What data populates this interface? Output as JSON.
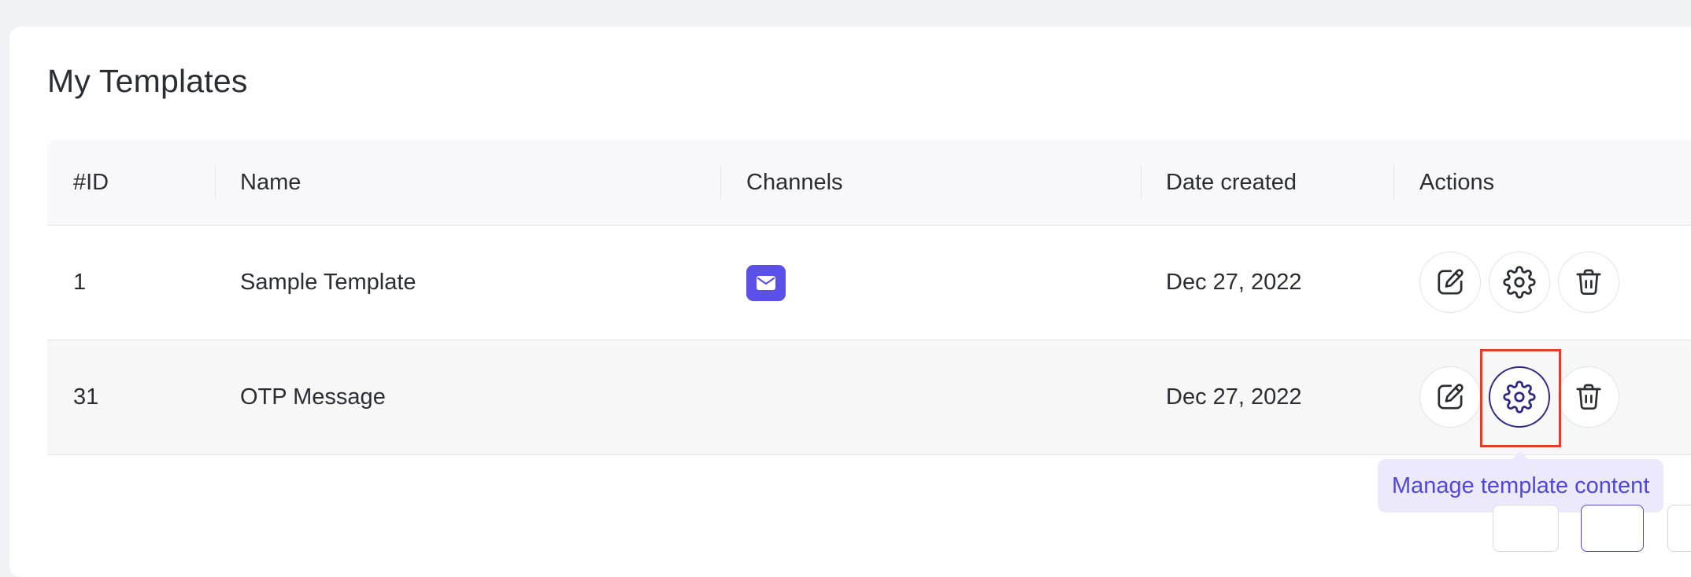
{
  "page": {
    "title": "My Templates"
  },
  "table": {
    "columns": [
      "#ID",
      "Name",
      "Channels",
      "Date created",
      "Actions"
    ],
    "rows": [
      {
        "id": "1",
        "name": "Sample Template",
        "channels": [
          "email"
        ],
        "date_created": "Dec 27, 2022",
        "actions": [
          "edit",
          "settings",
          "delete"
        ]
      },
      {
        "id": "31",
        "name": "OTP Message",
        "channels": [],
        "date_created": "Dec 27, 2022",
        "actions": [
          "edit",
          "settings",
          "delete"
        ]
      }
    ]
  },
  "tooltip": {
    "text": "Manage template content"
  },
  "icons": {
    "edit": "pencil-edit-icon",
    "settings": "gear-icon",
    "delete": "trash-icon",
    "channel_email": "mail-icon"
  },
  "colors": {
    "accent": "#5b51e8",
    "active_ring": "#2d2a86",
    "tooltip_bg": "#ebe9fb",
    "tooltip_text": "#5147d9",
    "highlight": "#e53b2c"
  }
}
